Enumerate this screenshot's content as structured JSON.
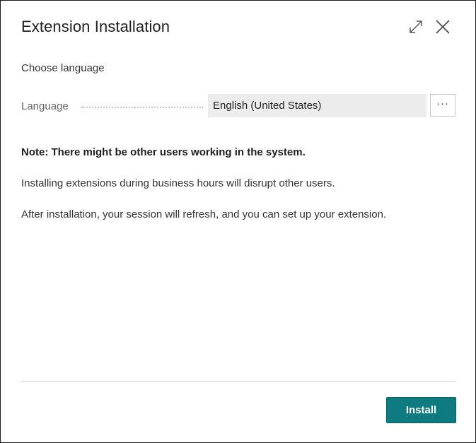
{
  "dialog": {
    "title": "Extension Installation",
    "icons": {
      "expand": "expand-icon",
      "close": "close-icon"
    }
  },
  "content": {
    "subtitle": "Choose language",
    "language_field": {
      "label": "Language",
      "value": "English (United States)",
      "lookup_label": "···"
    },
    "note": "Note: There might be other users working in the system.",
    "paragraphs": [
      "Installing extensions during business hours will disrupt other users.",
      "After installation, your session will refresh, and you can set up your extension."
    ]
  },
  "footer": {
    "install_label": "Install"
  },
  "colors": {
    "accent": "#0e7b80",
    "field_background": "#ececec",
    "border": "#1a1a1a"
  }
}
